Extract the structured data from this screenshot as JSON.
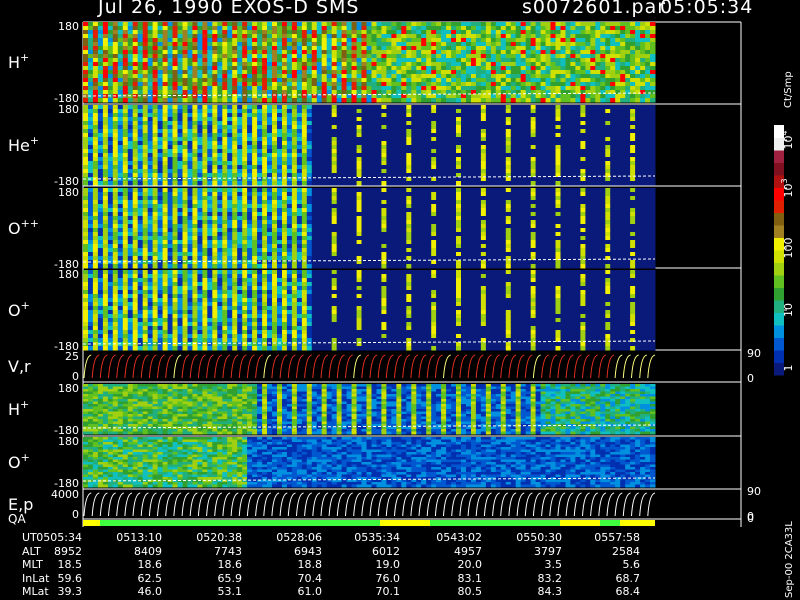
{
  "header": {
    "title": "Jul 26, 1990   EXOS-D SMS",
    "file": "s0072601.par",
    "time": "05:05:34"
  },
  "colors": {
    "background": "#000000",
    "foreground": "#ffffff",
    "scale": [
      "#0a1a7a",
      "#0030b0",
      "#0058d0",
      "#0090e0",
      "#10c0c0",
      "#20b080",
      "#30a030",
      "#60c020",
      "#a0d010",
      "#d0e000",
      "#f0f000",
      "#a08020",
      "#806010",
      "#e02000",
      "#ff0000",
      "#b01010",
      "#801020",
      "#a02040",
      "#f0f0f0",
      "#ffffff"
    ]
  },
  "chart_data": [
    {
      "type": "heatmap",
      "name": "H+",
      "ylim": [
        -180,
        180
      ],
      "tick_labels": [
        "180",
        "-180"
      ],
      "label": "H",
      "sup": "+"
    },
    {
      "type": "heatmap",
      "name": "He+",
      "ylim": [
        -180,
        180
      ],
      "tick_labels": [
        "180",
        "-180"
      ],
      "label": "He",
      "sup": "+"
    },
    {
      "type": "heatmap",
      "name": "O++",
      "ylim": [
        -180,
        180
      ],
      "tick_labels": [
        "180",
        "-180"
      ],
      "label": "O",
      "sup": "++"
    },
    {
      "type": "heatmap",
      "name": "O+",
      "ylim": [
        -180,
        180
      ],
      "tick_labels": [
        "180",
        "-180"
      ],
      "label": "O",
      "sup": "+"
    },
    {
      "type": "line",
      "name": "V,r",
      "ylim": [
        0,
        25
      ],
      "tick_labels": [
        "25",
        "0"
      ],
      "right_ticks": [
        "90",
        "0"
      ],
      "label": "V,r",
      "sup": ""
    },
    {
      "type": "heatmap",
      "name": "H+",
      "ylim": [
        -180,
        180
      ],
      "tick_labels": [
        "180",
        "-180"
      ],
      "label": "H",
      "sup": "+"
    },
    {
      "type": "heatmap",
      "name": "O+",
      "ylim": [
        -180,
        180
      ],
      "tick_labels": [
        "180",
        "-180"
      ],
      "label": "O",
      "sup": "+"
    },
    {
      "type": "line",
      "name": "E,p",
      "ylim": [
        0,
        4000
      ],
      "tick_labels": [
        "4000",
        "0"
      ],
      "right_ticks": [
        "90",
        "0"
      ],
      "label": "E,p",
      "sup": ""
    }
  ],
  "colorbar": {
    "type": "log",
    "range": [
      1,
      10000
    ],
    "label": "Ct/Smp",
    "ticks": [
      "10",
      "3",
      "100",
      "10",
      "1"
    ],
    "tick_base": "10",
    "tick_exponents": [
      "4",
      "3",
      "",
      "",
      ""
    ]
  },
  "qa": {
    "label": "QA",
    "right_ticks": [
      "90",
      "0"
    ]
  },
  "footer_label": "Sep-00  2CA33L",
  "table": {
    "rows": [
      {
        "label": "UT",
        "values": [
          "0505:34",
          "0513:10",
          "0520:38",
          "0528:06",
          "0535:34",
          "0543:02",
          "0550:30",
          "0557:58"
        ]
      },
      {
        "label": "ALT",
        "values": [
          "8952",
          "8409",
          "7743",
          "6943",
          "6012",
          "4957",
          "3797",
          "2584"
        ]
      },
      {
        "label": "MLT",
        "values": [
          "18.5",
          "18.6",
          "18.6",
          "18.8",
          "19.0",
          "20.0",
          "3.5",
          "5.6"
        ]
      },
      {
        "label": "InLat",
        "values": [
          "59.6",
          "62.5",
          "65.9",
          "70.4",
          "76.0",
          "83.1",
          "83.2",
          "68.7"
        ]
      },
      {
        "label": "MLat",
        "values": [
          "39.3",
          "46.0",
          "53.1",
          "61.0",
          "70.1",
          "80.5",
          "84.3",
          "68.4"
        ]
      }
    ]
  }
}
